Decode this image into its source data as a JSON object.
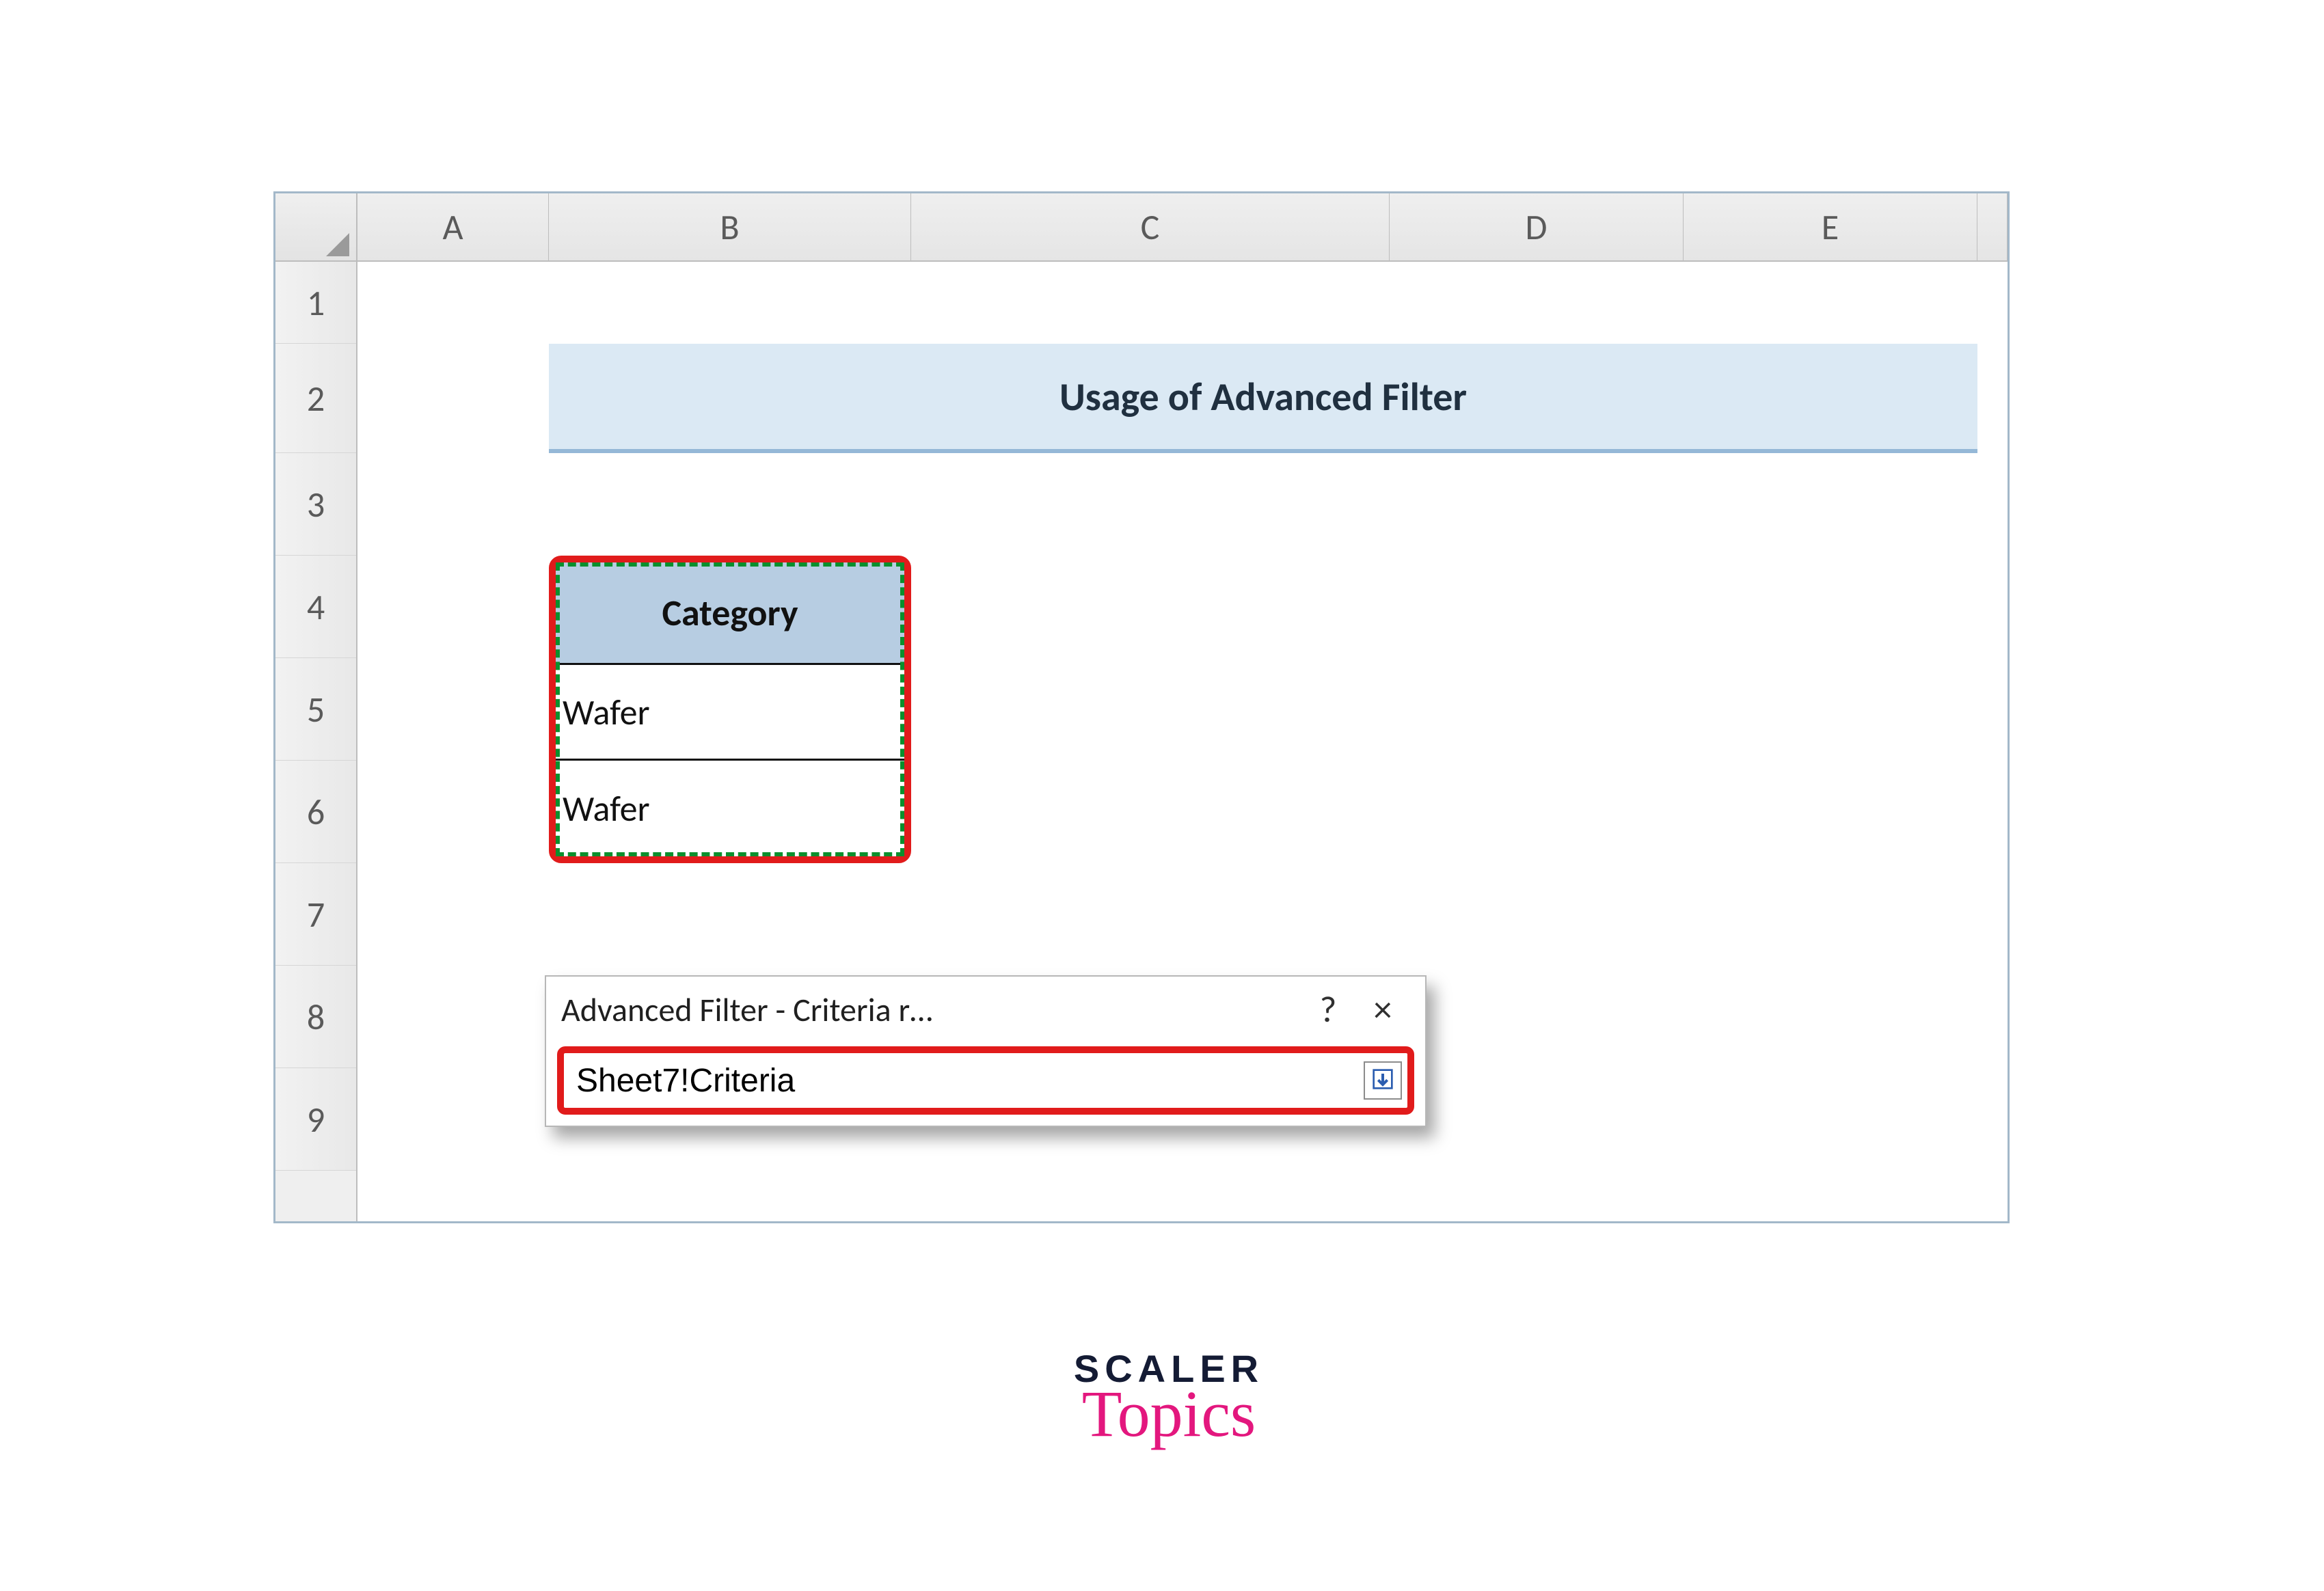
{
  "columns": {
    "A": "A",
    "B": "B",
    "C": "C",
    "D": "D",
    "E": "E"
  },
  "rows": [
    "1",
    "2",
    "3",
    "4",
    "5",
    "6",
    "7",
    "8",
    "9"
  ],
  "title_banner": "Usage of Advanced Filter",
  "criteria": {
    "header": "Category",
    "values": [
      "Wafer",
      "Wafer"
    ]
  },
  "dialog": {
    "title": "Advanced Filter - Criteria r…",
    "help_symbol": "?",
    "close_symbol": "×",
    "range_value": "Sheet7!Criteria"
  },
  "brand": {
    "line1": "SCALER",
    "line2": "Topics"
  }
}
